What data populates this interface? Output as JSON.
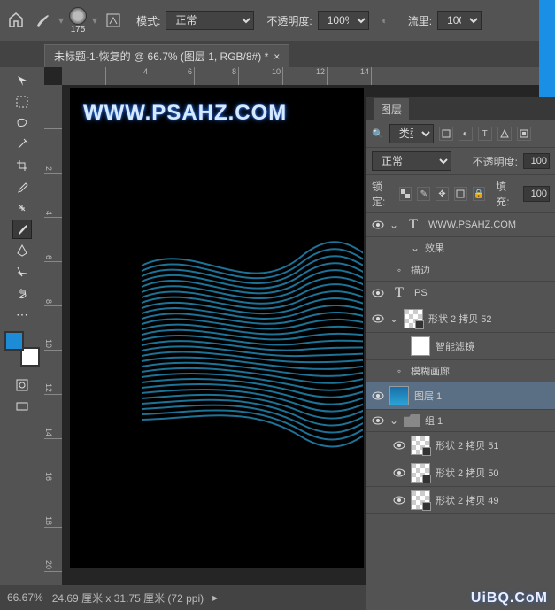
{
  "topbar": {
    "brush_size": "175",
    "mode_label": "模式:",
    "mode_value": "正常",
    "opacity_label": "不透明度:",
    "opacity_value": "100%",
    "flow_label": "流里:",
    "flow_value": "100%"
  },
  "tab": {
    "title": "未标题-1-恢复的 @ 66.7% (图层 1, RGB/8#) *"
  },
  "ruler_h": [
    "",
    "4",
    "6",
    "8",
    "10",
    "12",
    "14"
  ],
  "ruler_v": [
    "",
    "2",
    "4",
    "6",
    "8",
    "10",
    "12",
    "14",
    "16",
    "18",
    "20"
  ],
  "canvas": {
    "watermark": "WWW.PSAHZ.COM"
  },
  "layers_panel": {
    "tab": "图层",
    "filter_label": "类型",
    "blend_value": "正常",
    "opacity_label": "不透明度:",
    "opacity_value": "100",
    "lock_label": "锁定:",
    "fill_label": "填充:",
    "fill_value": "100"
  },
  "layers": [
    {
      "kind": "text",
      "name": "WWW.PSAHZ.COM",
      "visible": true,
      "expanded": true
    },
    {
      "kind": "fx",
      "name": "效果",
      "sub": true,
      "arrow": true
    },
    {
      "kind": "fx",
      "name": "描边",
      "sub": true,
      "dot": true
    },
    {
      "kind": "text",
      "name": "PS",
      "visible": true,
      "hidden_eye": true
    },
    {
      "kind": "smart",
      "name": "形状 2 拷贝 52",
      "visible": true,
      "expanded": true
    },
    {
      "kind": "sf",
      "name": "智能滤镜",
      "sub": true,
      "thumb": "white"
    },
    {
      "kind": "fx",
      "name": "模糊画廊",
      "sub": true,
      "dot": true
    },
    {
      "kind": "raster",
      "name": "图层 1",
      "visible": true,
      "selected": true,
      "thumb": "blue"
    },
    {
      "kind": "group",
      "name": "组 1",
      "visible": true,
      "expanded": true
    },
    {
      "kind": "smart",
      "name": "形状 2 拷贝 51",
      "visible": true,
      "sub": true
    },
    {
      "kind": "smart",
      "name": "形状 2 拷贝 50",
      "visible": true,
      "sub": true
    },
    {
      "kind": "smart",
      "name": "形状 2 拷贝 49",
      "visible": true,
      "sub": true
    }
  ],
  "status": {
    "zoom": "66.67%",
    "doc": "24.69 厘米 x 31.75 厘米 (72 ppi)"
  },
  "site_watermark": "UiBQ.CoM"
}
